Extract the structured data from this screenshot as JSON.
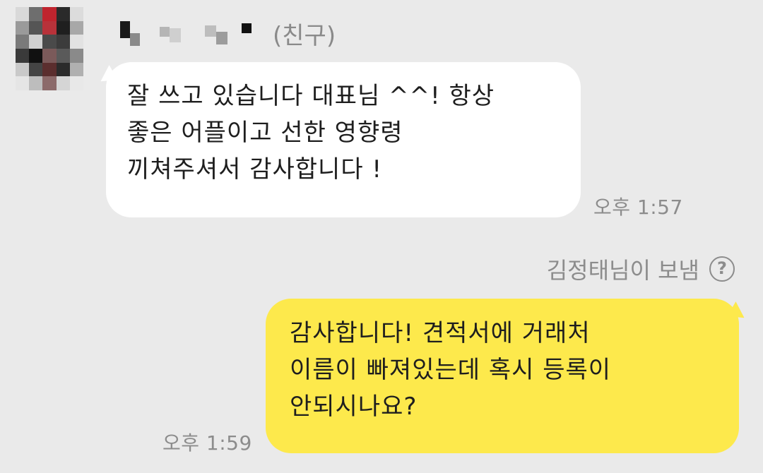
{
  "incoming": {
    "sender_tag": "(친구)",
    "message_lines": [
      "잘 쓰고 있습니다 대표님 ^^!  항상",
      "좋은 어플이고 선한 영향령",
      "끼쳐주셔서 감사합니다 !"
    ],
    "time": "오후 1:57"
  },
  "outgoing": {
    "sent_by_label": "김정태님이 보냄",
    "help_icon_glyph": "?",
    "message_lines": [
      "감사합니다! 견적서에 거래처",
      "이름이 빠져있는데 혹시 등록이",
      "안되시나요?"
    ],
    "time": "오후 1:59"
  },
  "colors": {
    "background": "#eaeaea",
    "incoming_bubble": "#ffffff",
    "outgoing_bubble": "#fde94c",
    "meta_text": "#8c8c8c"
  },
  "icons": {
    "avatar": "blurred-profile-avatar",
    "help": "question-circle-icon"
  }
}
